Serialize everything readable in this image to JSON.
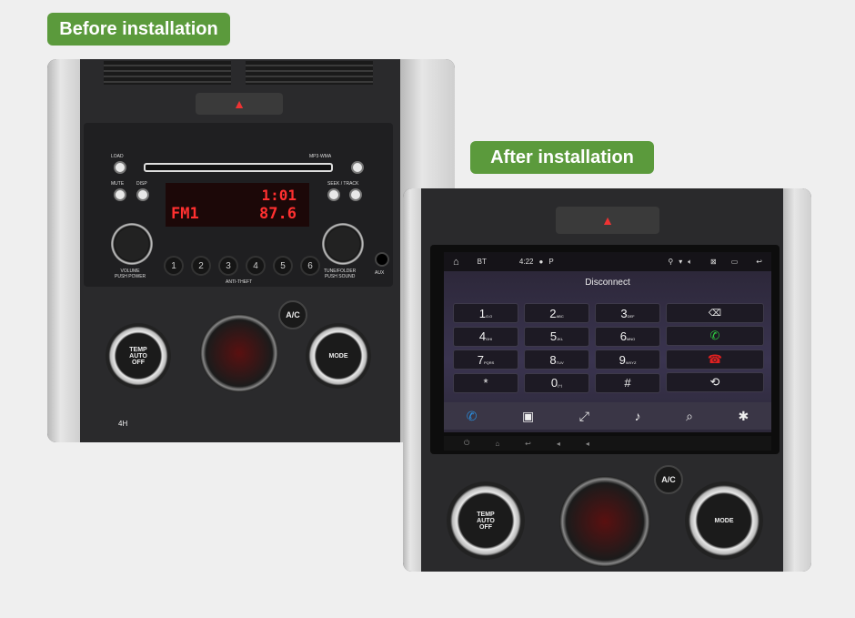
{
  "before_label": "Before installation",
  "after_label": "After installation",
  "radio": {
    "load": "LOAD",
    "mute": "MUTE",
    "disp": "DISP",
    "seek_track": "SEEK / TRACK",
    "volume": "VOLUME",
    "push_power": "PUSH POWER",
    "tune_folder": "TUNE/FOLDER",
    "push_sound": "PUSH SOUND",
    "aux": "AUX",
    "anti_theft": "ANTI-THEFT",
    "mp3": "MP3·WMA",
    "band": "FM1",
    "frequency": "87.6",
    "preset_display": "1:01",
    "presets": [
      "1",
      "2",
      "3",
      "4",
      "5",
      "6"
    ]
  },
  "climate": {
    "temp": "TEMP",
    "auto": "AUTO",
    "off": "OFF",
    "ac": "A/C",
    "mode": "MODE",
    "four_h": "4H"
  },
  "android": {
    "status": {
      "app": "BT",
      "time": "4:22"
    },
    "title": "Disconnect",
    "keys": [
      {
        "digit": "1",
        "letters": "O.O"
      },
      {
        "digit": "2",
        "letters": "ABC"
      },
      {
        "digit": "3",
        "letters": "DEF"
      },
      {
        "digit": "4",
        "letters": "GHI"
      },
      {
        "digit": "5",
        "letters": "JKL"
      },
      {
        "digit": "6",
        "letters": "MNO"
      },
      {
        "digit": "7",
        "letters": "PQRS"
      },
      {
        "digit": "8",
        "letters": "TUV"
      },
      {
        "digit": "9",
        "letters": "WXYZ"
      },
      {
        "digit": "*",
        "letters": ""
      },
      {
        "digit": "0",
        "letters": "(+)"
      },
      {
        "digit": "#",
        "letters": ""
      }
    ],
    "colors": {
      "call": "#2ecc40",
      "hangup": "#e02020",
      "dial_tab": "#2a8fe0"
    },
    "dock_icons": [
      "phone-icon",
      "contacts-icon",
      "transfer-icon",
      "music-icon",
      "search-icon",
      "settings-icon"
    ]
  }
}
